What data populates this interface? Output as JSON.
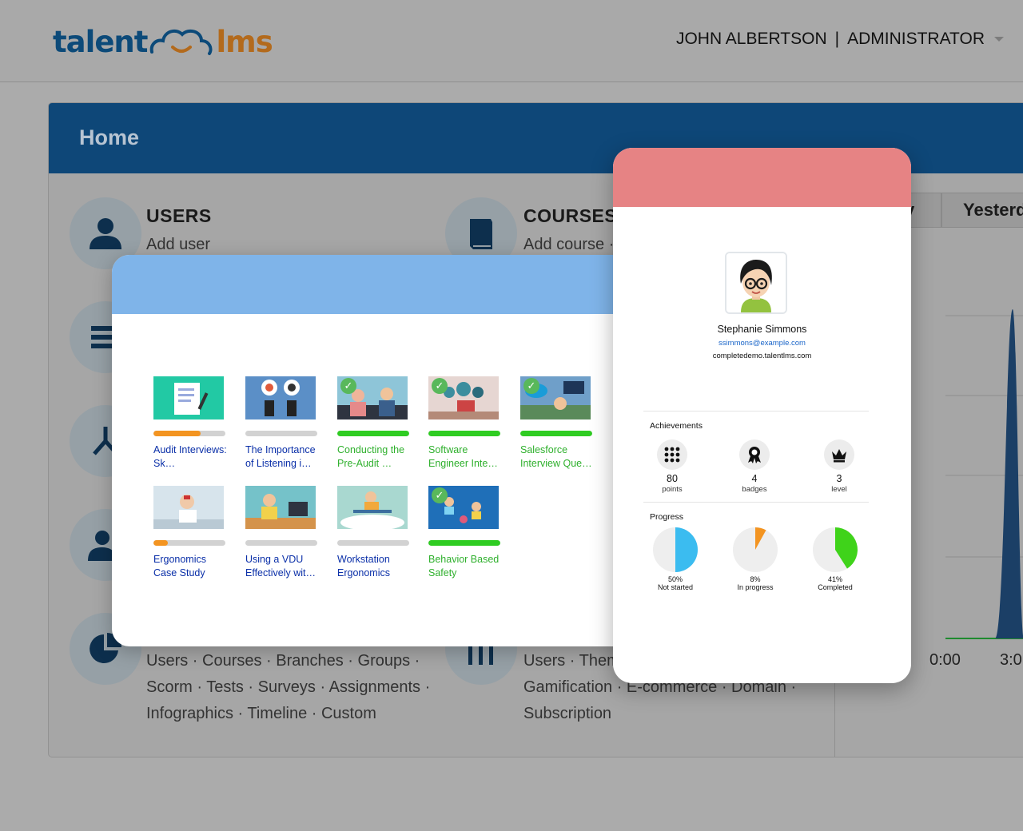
{
  "topbar": {
    "logo_left": "talent",
    "logo_right": "lms",
    "user_name": "JOHN ALBERTSON",
    "separator": "|",
    "user_role": "ADMINISTRATOR"
  },
  "home": {
    "title": "Home",
    "tiles": {
      "users": {
        "title": "USERS",
        "links": "Add user"
      },
      "courses": {
        "title": "COURSES",
        "links": "Add course ·"
      },
      "reports": {
        "links_1": "Users · Courses · Branches · Groups ·",
        "links_2": "Scorm · Tests · Surveys · Assignments ·",
        "links_3": "Infographics · Timeline · Custom"
      },
      "settings": {
        "links_1": "Users · Them",
        "links_2": "Gamification · E-commerce · Domain ·",
        "links_3": "Subscription"
      }
    },
    "tabs": {
      "today_tail": "y",
      "yesterday": "Yesterd"
    },
    "chart_axis": {
      "x0": "0:00",
      "x1": "3:0"
    }
  },
  "courses": [
    {
      "name": "Audit Interviews: Sk…",
      "progress": 0.65,
      "completed": false
    },
    {
      "name": "The Importance of Listening i…",
      "progress": 0,
      "completed": false
    },
    {
      "name": "Conducting the Pre-Audit …",
      "progress": 1.0,
      "completed": true
    },
    {
      "name": "Software Engineer Inte…",
      "progress": 1.0,
      "completed": true
    },
    {
      "name": "Salesforce Interview Que…",
      "progress": 1.0,
      "completed": true
    },
    {
      "name": "Ergonomics Case Study",
      "progress": 0.2,
      "completed": false
    },
    {
      "name": "Using a VDU Effectively wit…",
      "progress": 0,
      "completed": false
    },
    {
      "name": "Workstation Ergonomics",
      "progress": 0,
      "completed": false
    },
    {
      "name": "Behavior Based Safety",
      "progress": 1.0,
      "completed": true
    }
  ],
  "profile": {
    "name": "Stephanie Simmons",
    "email": "ssimmons@example.com",
    "site": "completedemo.talentlms.com",
    "achievements_title": "Achievements",
    "achievements": [
      {
        "icon": "points-grid-icon",
        "value": "80",
        "label": "points"
      },
      {
        "icon": "badge-ribbon-icon",
        "value": "4",
        "label": "badges"
      },
      {
        "icon": "crown-icon",
        "value": "3",
        "label": "level"
      }
    ],
    "progress_title": "Progress",
    "progress": [
      {
        "pct": "50%",
        "label": "Not started",
        "fraction": 0.5,
        "color": "#3bbcf0"
      },
      {
        "pct": "8%",
        "label": "In progress",
        "fraction": 0.08,
        "color": "#f39421"
      },
      {
        "pct": "41%",
        "label": "Completed",
        "fraction": 0.41,
        "color": "#3fd31a"
      }
    ]
  },
  "colors": {
    "brand_dark": "#0e4778",
    "courses_header": "#7fb4e9",
    "profile_header": "#e68384",
    "progress_orange": "#f39421",
    "progress_green": "#2fcc22"
  }
}
